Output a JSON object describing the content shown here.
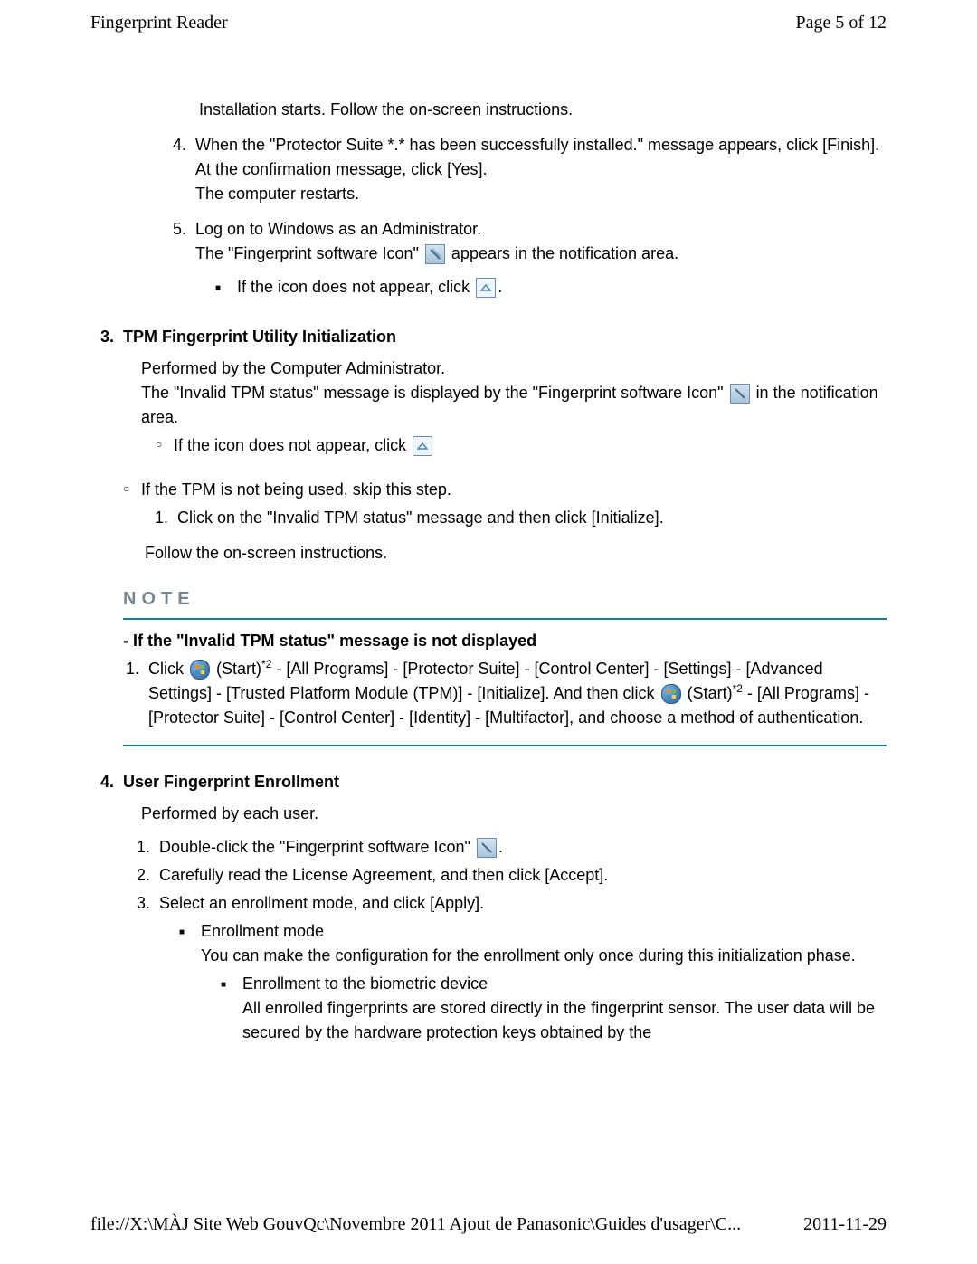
{
  "header": {
    "title": "Fingerprint Reader",
    "page": "Page 5 of 12"
  },
  "footer": {
    "path": "file://X:\\MÀJ Site Web GouvQc\\Novembre 2011 Ajout de Panasonic\\Guides d'usager\\C...",
    "date": "2011-11-29"
  },
  "s1": {
    "p0": "Installation starts. Follow the on-screen instructions.",
    "i4": {
      "num": "4.",
      "l1": "When the \"Protector Suite *.* has been successfully installed.\" message appears, click [Finish].",
      "l2": "At the confirmation message, click [Yes].",
      "l3": "The computer restarts."
    },
    "i5": {
      "num": "5.",
      "l1": "Log on to Windows as an Administrator.",
      "l2a": "The \"Fingerprint software Icon\"",
      "l2b": "appears in the notification area.",
      "b1a": "If the icon does not appear, click",
      "b1b": "."
    }
  },
  "s3": {
    "num": "3.",
    "title": "TPM Fingerprint Utility Initialization",
    "p1": "Performed by the Computer Administrator.",
    "p2a": "The \"Invalid TPM status\" message is displayed by the \"Fingerprint software Icon\"",
    "p2b": "in the notification area.",
    "c1a": "If the icon does not appear, click",
    "c2": "If the TPM is not being used, skip this step.",
    "sub1": {
      "num": "1.",
      "text": "Click on the \"Invalid TPM status\" message and then click [Initialize]."
    },
    "p3": "Follow the on-screen instructions.",
    "note_label": "NOTE",
    "note_h": "- If the \"Invalid TPM status\" message is not displayed",
    "note1_num": "1.",
    "nt1": "Click",
    "nt2": "(Start)",
    "nt2sup": "*2",
    "nt3": " - [All Programs] - [Protector Suite] - [Control Center] - [Settings] - [Advanced Settings] - [Trusted Platform Module (TPM)] - [Initialize]. And then click",
    "nt4": "(Start)",
    "nt4sup": "*2",
    "nt5": " - [All Programs] - [Protector Suite] - [Control Center] - [Identity] - [Multifactor], and choose a method of authentication."
  },
  "s4": {
    "num": "4.",
    "title": "User Fingerprint Enrollment",
    "p1": "Performed by each user.",
    "i1": {
      "num": "1.",
      "a": "Double-click the \"Fingerprint software Icon\"",
      "b": "."
    },
    "i2": {
      "num": "2.",
      "t": "Carefully read the License Agreement, and then click [Accept]."
    },
    "i3": {
      "num": "3.",
      "t": "Select an enrollment mode, and click [Apply].",
      "b1": "Enrollment mode",
      "b1p": "You can make the configuration for the enrollment only once during this initialization phase.",
      "bb1": "Enrollment to the biometric device",
      "bb1p": "All enrolled fingerprints are stored directly in the fingerprint sensor. The user data will be secured by the hardware protection keys obtained by the"
    }
  }
}
